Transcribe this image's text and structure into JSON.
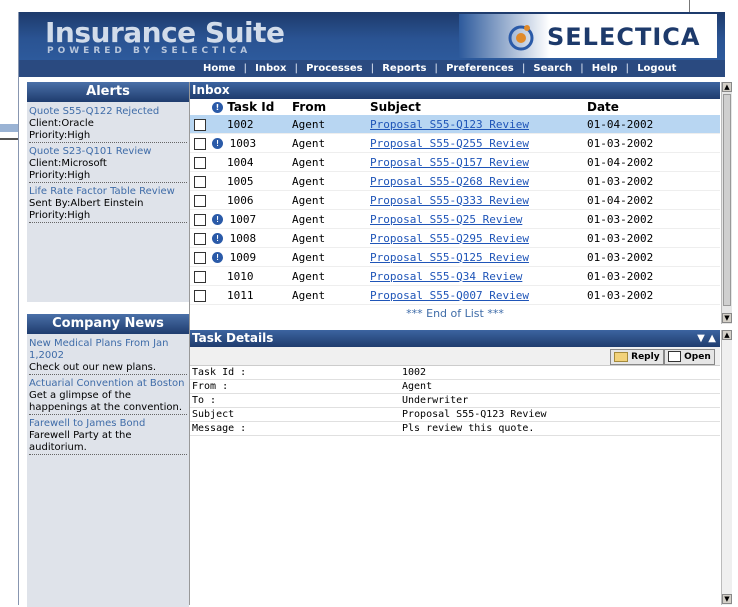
{
  "header": {
    "app_title": "Insurance Suite",
    "app_subtitle": "POWERED BY SELECTICA",
    "brand": "SELECTICA"
  },
  "nav": [
    "Home",
    "Inbox",
    "Processes",
    "Reports",
    "Preferences",
    "Search",
    "Help",
    "Logout"
  ],
  "alerts": {
    "title": "Alerts",
    "items": [
      {
        "link": "Quote S55-Q122 Rejected",
        "lines": [
          "Client:Oracle",
          "Priority:High"
        ]
      },
      {
        "link": "Quote S23-Q101 Review",
        "lines": [
          "Client:Microsoft",
          "Priority:High"
        ]
      },
      {
        "link": "Life Rate Factor Table Review",
        "lines": [
          "Sent By:Albert Einstein",
          "Priority:High"
        ]
      }
    ]
  },
  "news": {
    "title": "Company News",
    "items": [
      {
        "link": "New Medical Plans From Jan 1,2002",
        "text": "Check out our new plans."
      },
      {
        "link": "Actuarial Convention at Boston",
        "text": "Get a glimpse of the happenings at the convention."
      },
      {
        "link": "Farewell to James Bond",
        "text": "Farewell Party at the auditorium."
      }
    ]
  },
  "inbox": {
    "title": "Inbox",
    "columns": {
      "task_id": "Task Id",
      "from": "From",
      "subject": "Subject",
      "date": "Date"
    },
    "rows": [
      {
        "id": "1002",
        "from": "Agent",
        "subject": "Proposal S55-Q123 Review",
        "date": "01-04-2002",
        "info": false,
        "selected": true
      },
      {
        "id": "1003",
        "from": "Agent",
        "subject": "Proposal S55-Q255 Review",
        "date": "01-03-2002",
        "info": true,
        "selected": false
      },
      {
        "id": "1004",
        "from": "Agent",
        "subject": "Proposal S55-Q157 Review",
        "date": "01-04-2002",
        "info": false,
        "selected": false
      },
      {
        "id": "1005",
        "from": "Agent",
        "subject": "Proposal S55-Q268 Review",
        "date": "01-03-2002",
        "info": false,
        "selected": false
      },
      {
        "id": "1006",
        "from": "Agent",
        "subject": "Proposal S55-Q333 Review",
        "date": "01-04-2002",
        "info": false,
        "selected": false
      },
      {
        "id": "1007",
        "from": "Agent",
        "subject": "Proposal S55-Q25 Review",
        "date": "01-03-2002",
        "info": true,
        "selected": false
      },
      {
        "id": "1008",
        "from": "Agent",
        "subject": "Proposal S55-Q295 Review",
        "date": "01-03-2002",
        "info": true,
        "selected": false
      },
      {
        "id": "1009",
        "from": "Agent",
        "subject": "Proposal S55-Q125 Review",
        "date": "01-03-2002",
        "info": true,
        "selected": false
      },
      {
        "id": "1010",
        "from": "Agent",
        "subject": "Proposal S55-Q34 Review",
        "date": "01-03-2002",
        "info": false,
        "selected": false
      },
      {
        "id": "1011",
        "from": "Agent",
        "subject": "Proposal S55-Q007 Review",
        "date": "01-03-2002",
        "info": false,
        "selected": false
      }
    ],
    "end_label": "*** End of List ***"
  },
  "details": {
    "title": "Task Details",
    "reply_label": "Reply",
    "open_label": "Open",
    "fields": [
      {
        "label": "Task Id :",
        "value": "1002"
      },
      {
        "label": "From :",
        "value": "Agent"
      },
      {
        "label": "To :",
        "value": "Underwriter"
      },
      {
        "label": "Subject",
        "value": "Proposal S55-Q123 Review"
      },
      {
        "label": "Message :",
        "value": "Pls review this quote."
      }
    ]
  },
  "colors": {
    "brand_navy": "#1d3a6b",
    "link_blue": "#1f55b8",
    "selected_row": "#b8d6f2"
  }
}
